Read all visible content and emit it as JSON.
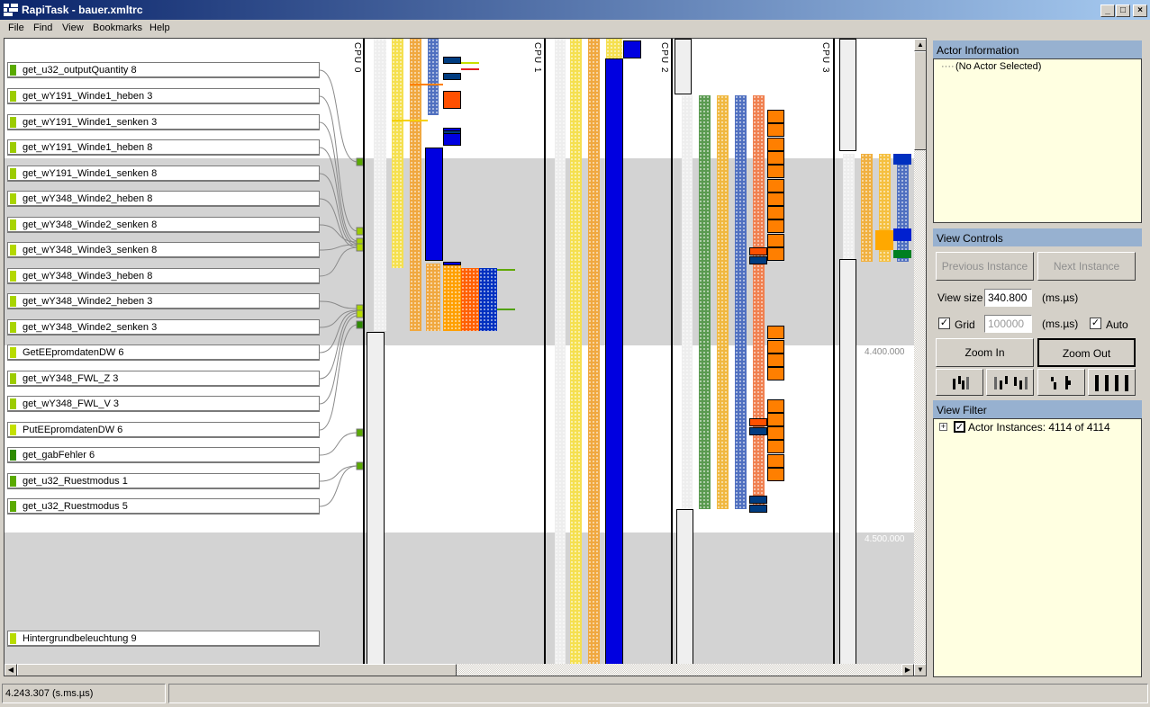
{
  "window": {
    "title": "RapiTask - bauer.xmltrc",
    "icon": "app-icon",
    "minimize": "_",
    "maximize": "□",
    "close": "×"
  },
  "menu": [
    "File",
    "Find",
    "View",
    "Bookmarks",
    "Help"
  ],
  "actors": [
    {
      "label": "get_u32_outputQuantity 8",
      "color": "#5aaa00"
    },
    {
      "label": "get_wY191_Winde1_heben 3",
      "color": "#9ccc00"
    },
    {
      "label": "get_wY191_Winde1_senken 3",
      "color": "#9ccc00"
    },
    {
      "label": "get_wY191_Winde1_heben 8",
      "color": "#9ccc00"
    },
    {
      "label": "get_wY191_Winde1_senken 8",
      "color": "#9ccc00"
    },
    {
      "label": "get_wY348_Winde2_heben 8",
      "color": "#a8d400"
    },
    {
      "label": "get_wY348_Winde2_senken 8",
      "color": "#a8d400"
    },
    {
      "label": "get_wY348_Winde3_senken 8",
      "color": "#b4d800"
    },
    {
      "label": "get_wY348_Winde3_heben 8",
      "color": "#b4d800"
    },
    {
      "label": "get_wY348_Winde2_heben 3",
      "color": "#a8d400"
    },
    {
      "label": "get_wY348_Winde2_senken 3",
      "color": "#a8d400"
    },
    {
      "label": "GetEEpromdatenDW 6",
      "color": "#b8dc00"
    },
    {
      "label": "get_wY348_FWL_Z 3",
      "color": "#9ccc00"
    },
    {
      "label": "get_wY348_FWL_V 3",
      "color": "#9ccc00"
    },
    {
      "label": "PutEEpromdatenDW 6",
      "color": "#c4e000"
    },
    {
      "label": "get_gabFehler 6",
      "color": "#2e8b00"
    },
    {
      "label": "get_u32_Ruestmodus 1",
      "color": "#5aaa00"
    },
    {
      "label": "get_u32_Ruestmodus 5",
      "color": "#5aaa00"
    },
    {
      "label": "Hintergrundbeleuchtung 9",
      "color": "#b8dc00"
    }
  ],
  "cpus": [
    "CPU 0",
    "CPU 1",
    "CPU 2",
    "CPU 3"
  ],
  "time_labels": [
    "4.400.000",
    "4.500.000"
  ],
  "actor_info": {
    "title": "Actor Information",
    "tree_item": "(No Actor Selected)"
  },
  "view_controls": {
    "title": "View Controls",
    "prev": "Previous Instance",
    "next": "Next Instance",
    "view_size_label": "View size",
    "view_size_value": "340.800",
    "unit1": "(ms.µs)",
    "grid_label": "Grid",
    "grid_checked": true,
    "grid_value": "100000",
    "unit2": "(ms.µs)",
    "auto_label": "Auto",
    "auto_checked": true,
    "zoom_in": "Zoom In",
    "zoom_out": "Zoom Out",
    "layout_buttons": [
      "layout-mode-1-icon",
      "layout-mode-2-icon",
      "layout-mode-3-icon",
      "layout-mode-4-icon"
    ]
  },
  "view_filter": {
    "title": "View Filter",
    "item": "Actor Instances: 4114 of 4114",
    "checked": true
  },
  "status": {
    "time": "4.243.307 (s.ms.µs)",
    "right": ""
  },
  "colors": {
    "accent_header": "#97b1d0",
    "panel_bg": "#ffffe1",
    "blue": "#0000e0",
    "orange": "#ff7f00"
  }
}
